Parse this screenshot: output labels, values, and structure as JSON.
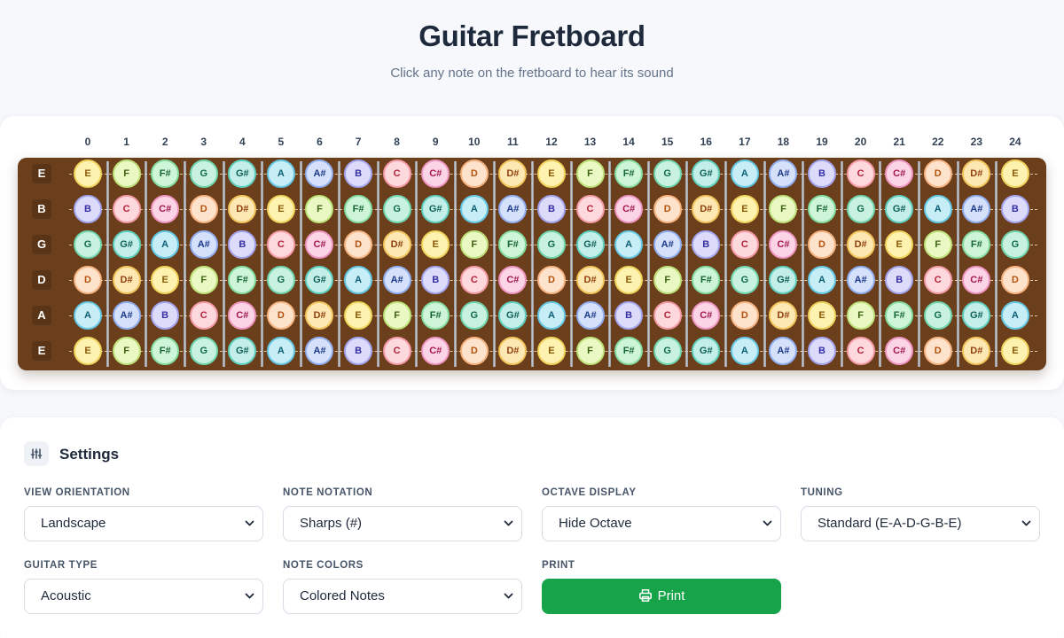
{
  "header": {
    "title": "Guitar Fretboard",
    "subtitle": "Click any note on the fretboard to hear its sound"
  },
  "fretboard": {
    "fret_numbers": [
      "0",
      "1",
      "2",
      "3",
      "4",
      "5",
      "6",
      "7",
      "8",
      "9",
      "10",
      "11",
      "12",
      "13",
      "14",
      "15",
      "16",
      "17",
      "18",
      "19",
      "20",
      "21",
      "22",
      "23",
      "24"
    ],
    "strings": [
      {
        "label": "E",
        "notes": [
          "E",
          "F",
          "F#",
          "G",
          "G#",
          "A",
          "A#",
          "B",
          "C",
          "C#",
          "D",
          "D#",
          "E",
          "F",
          "F#",
          "G",
          "G#",
          "A",
          "A#",
          "B",
          "C",
          "C#",
          "D",
          "D#",
          "E"
        ]
      },
      {
        "label": "B",
        "notes": [
          "B",
          "C",
          "C#",
          "D",
          "D#",
          "E",
          "F",
          "F#",
          "G",
          "G#",
          "A",
          "A#",
          "B",
          "C",
          "C#",
          "D",
          "D#",
          "E",
          "F",
          "F#",
          "G",
          "G#",
          "A",
          "A#",
          "B"
        ]
      },
      {
        "label": "G",
        "notes": [
          "G",
          "G#",
          "A",
          "A#",
          "B",
          "C",
          "C#",
          "D",
          "D#",
          "E",
          "F",
          "F#",
          "G",
          "G#",
          "A",
          "A#",
          "B",
          "C",
          "C#",
          "D",
          "D#",
          "E",
          "F",
          "F#",
          "G"
        ]
      },
      {
        "label": "D",
        "notes": [
          "D",
          "D#",
          "E",
          "F",
          "F#",
          "G",
          "G#",
          "A",
          "A#",
          "B",
          "C",
          "C#",
          "D",
          "D#",
          "E",
          "F",
          "F#",
          "G",
          "G#",
          "A",
          "A#",
          "B",
          "C",
          "C#",
          "D"
        ]
      },
      {
        "label": "A",
        "notes": [
          "A",
          "A#",
          "B",
          "C",
          "C#",
          "D",
          "D#",
          "E",
          "F",
          "F#",
          "G",
          "G#",
          "A",
          "A#",
          "B",
          "C",
          "C#",
          "D",
          "D#",
          "E",
          "F",
          "F#",
          "G",
          "G#",
          "A"
        ]
      },
      {
        "label": "E",
        "notes": [
          "E",
          "F",
          "F#",
          "G",
          "G#",
          "A",
          "A#",
          "B",
          "C",
          "C#",
          "D",
          "D#",
          "E",
          "F",
          "F#",
          "G",
          "G#",
          "A",
          "A#",
          "B",
          "C",
          "C#",
          "D",
          "D#",
          "E"
        ]
      }
    ],
    "colors": {
      "board": "#6b3f1c",
      "fret_wire": "#c9ccd1"
    },
    "note_colors": {
      "C": {
        "bg": "#fdd8dc",
        "border": "#f39ba6",
        "text": "#b4233a"
      },
      "C#": {
        "bg": "#fbd5e6",
        "border": "#ee96bf",
        "text": "#a3184f"
      },
      "D": {
        "bg": "#fde2cc",
        "border": "#f6b483",
        "text": "#b4530f"
      },
      "D#": {
        "bg": "#fde8b4",
        "border": "#f2c55c",
        "text": "#92400e"
      },
      "E": {
        "bg": "#fdf2b0",
        "border": "#efd35a",
        "text": "#8a5a08"
      },
      "F": {
        "bg": "#eaf8c4",
        "border": "#bde27a",
        "text": "#3f6212"
      },
      "F#": {
        "bg": "#cff5d9",
        "border": "#84dda0",
        "text": "#166534"
      },
      "G": {
        "bg": "#c8f1e0",
        "border": "#6fd6ad",
        "text": "#0f6b4c"
      },
      "G#": {
        "bg": "#c3efe8",
        "border": "#5fd0c0",
        "text": "#0f5f58"
      },
      "A": {
        "bg": "#c7eef7",
        "border": "#64c8e4",
        "text": "#0e5e74"
      },
      "A#": {
        "bg": "#d5e0fb",
        "border": "#91aef0",
        "text": "#1e3a8a"
      },
      "B": {
        "bg": "#dcdcfa",
        "border": "#a4a4ee",
        "text": "#3730a3"
      }
    }
  },
  "settings": {
    "title": "Settings",
    "icon": "sliders-icon",
    "fields": [
      {
        "label": "VIEW ORIENTATION",
        "value": "Landscape"
      },
      {
        "label": "NOTE NOTATION",
        "value": "Sharps (#)"
      },
      {
        "label": "OCTAVE DISPLAY",
        "value": "Hide Octave"
      },
      {
        "label": "TUNING",
        "value": "Standard (E-A-D-G-B-E)"
      },
      {
        "label": "GUITAR TYPE",
        "value": "Acoustic"
      },
      {
        "label": "NOTE COLORS",
        "value": "Colored Notes"
      }
    ],
    "print": {
      "label": "PRINT",
      "button": "Print",
      "icon": "printer-icon",
      "color": "#16a34a"
    }
  }
}
